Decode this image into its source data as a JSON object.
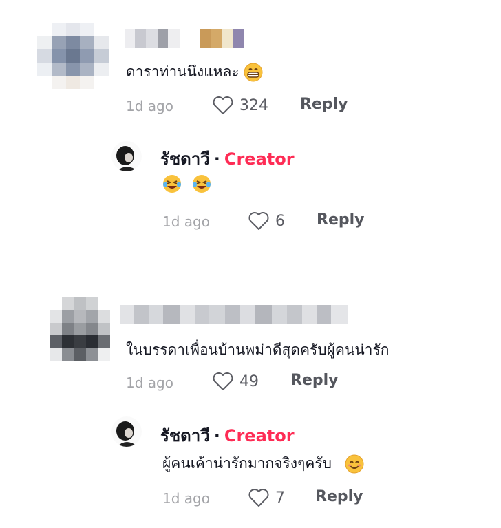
{
  "comments": [
    {
      "text": "ดาราท่านนึงแหละ",
      "emoji": "grinning-face-icon",
      "time": "1d ago",
      "likes": "324",
      "reply_label": "Reply",
      "reply": {
        "author": "รัชดาวี",
        "separator": "·",
        "creator_tag": "Creator",
        "text": "",
        "emojis": [
          "laughing-tears-icon",
          "laughing-tears-icon"
        ],
        "time": "1d ago",
        "likes": "6",
        "reply_label": "Reply"
      }
    },
    {
      "text": "ในบรรดาเพื่อนบ้านพม่าดีสุดครับผู้คนน่ารัก",
      "time": "1d ago",
      "likes": "49",
      "reply_label": "Reply",
      "reply": {
        "author": "รัชดาวี",
        "separator": "·",
        "creator_tag": "Creator",
        "text": "ผู้คนเค้าน่ารักมากจริงๆครับ",
        "emojis": [
          "smiling-face-icon"
        ],
        "time": "1d ago",
        "likes": "7",
        "reply_label": "Reply"
      }
    }
  ],
  "colors": {
    "creator_tag": "#fe2c55",
    "meta": "#a3a4a8",
    "text": "#161823"
  }
}
